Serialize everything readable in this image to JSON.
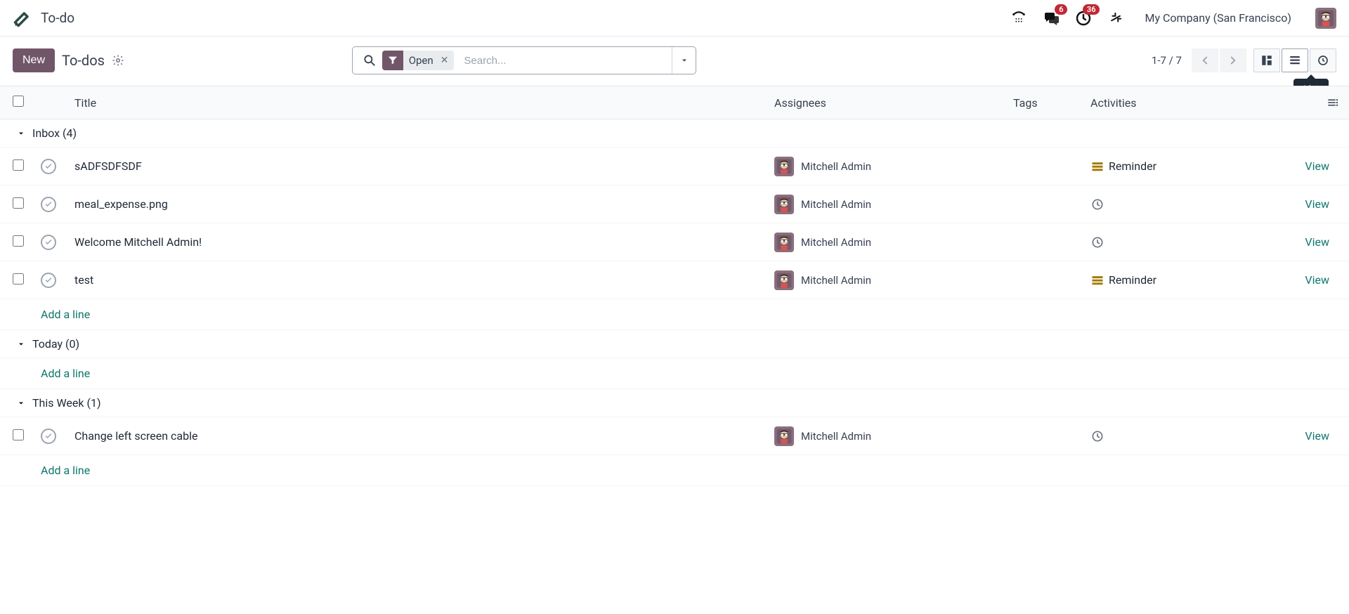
{
  "app": {
    "title": "To-do"
  },
  "topnav": {
    "messages_badge": "6",
    "activities_badge": "36",
    "company": "My Company (San Francisco)"
  },
  "control": {
    "new_label": "New",
    "breadcrumb": "To-dos",
    "filter_chip": "Open",
    "search_placeholder": "Search...",
    "pager": "1-7 / 7",
    "list_tooltip": "List"
  },
  "columns": {
    "title": "Title",
    "assignees": "Assignees",
    "tags": "Tags",
    "activities": "Activities"
  },
  "groups": {
    "inbox": "Inbox (4)",
    "today": "Today (0)",
    "this_week": "This Week (1)"
  },
  "rows": {
    "r1": {
      "title": "sADFSDFSDF",
      "assignee": "Mitchell Admin",
      "activity_type": "reminder",
      "activity_label": "Reminder",
      "view": "View"
    },
    "r2": {
      "title": "meal_expense.png",
      "assignee": "Mitchell Admin",
      "activity_type": "clock",
      "view": "View"
    },
    "r3": {
      "title": "Welcome Mitchell Admin!",
      "assignee": "Mitchell Admin",
      "activity_type": "clock",
      "view": "View"
    },
    "r4": {
      "title": "test",
      "assignee": "Mitchell Admin",
      "activity_type": "reminder",
      "activity_label": "Reminder",
      "view": "View"
    },
    "r5": {
      "title": "Change left screen cable",
      "assignee": "Mitchell Admin",
      "activity_type": "clock",
      "view": "View"
    }
  },
  "add_line": "Add a line"
}
